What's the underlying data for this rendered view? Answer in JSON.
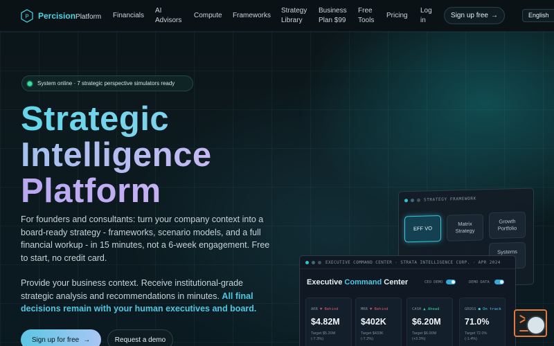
{
  "nav": {
    "brand": "Percision",
    "brand_suffix": "Platform",
    "logo_letter": "P",
    "links": [
      {
        "label": "Financials"
      },
      {
        "label": "AI\nAdvisors"
      },
      {
        "label": "Compute"
      },
      {
        "label": "Frameworks"
      },
      {
        "label": "Strategy\nLibrary"
      },
      {
        "label": "Business\nPlan $99"
      },
      {
        "label": "Free\nTools"
      },
      {
        "label": "Pricing"
      },
      {
        "label": "Log\nin"
      }
    ],
    "signup_label": "Sign up free",
    "signup_arrow": "→",
    "language": "English"
  },
  "hero": {
    "status_text": "System online · 7 strategic perspective simulators ready",
    "title_line1": "Strategic",
    "title_line2": "Intelligence",
    "title_line3": "Platform",
    "lead": "For founders and consultants: turn your company context into a board-ready strategy - frameworks, scenario models, and a full financial workup - in 15 minutes, not a 6-week engagement. Free to start, no credit card.",
    "lead2_plain": "Provide your business context. Receive institutional-grade strategic analysis and recommendations in minutes. ",
    "lead2_highlight": "All final decisions remain with your human executives and board.",
    "cta_primary": "Sign up for free",
    "cta_primary_arrow": "→",
    "cta_secondary": "Request a demo"
  },
  "strategy_framework": {
    "title": "STRATEGY FRAMEWORK",
    "cells": [
      {
        "label": "EFF VO"
      },
      {
        "label": "Matrix\nStrategy"
      },
      {
        "label": "Growth\nPortfolio"
      },
      {
        "label": "Systems\nMap"
      }
    ]
  },
  "command_center": {
    "header": "EXECUTIVE COMMAND CENTER · STRATA INTELLIGENCE CORP. · APR 2024",
    "title_plain": "Executive ",
    "title_accent": "Command",
    "title_rest": " Center",
    "toggle1": "CEO DEMO",
    "toggle2": "DEMO DATA",
    "kpis": [
      {
        "label": "ARR",
        "status": "▼ Behind",
        "status_color": "#e0566a",
        "value": "$4.82M",
        "target": "Target $5.20M\n(-7.3%)"
      },
      {
        "label": "MRR",
        "status": "▼ Behind",
        "status_color": "#e0566a",
        "value": "$402K",
        "target": "Target $433K\n(-7.2%)"
      },
      {
        "label": "CASH",
        "status": "▲ Ahead",
        "status_color": "#37d39a",
        "value": "$6.20M",
        "target": "Target $6.00M\n(+3.3%)"
      },
      {
        "label": "GROSS",
        "status": "● On track",
        "status_color": "#4fc8e6",
        "value": "71.0%",
        "target": "Target 72.0%\n(-1.4%)"
      }
    ]
  },
  "colors": {
    "accent_cyan": "#4fd6e6",
    "accent_purple": "#c6b8f3",
    "behind": "#e0566a",
    "ahead": "#37d39a"
  }
}
